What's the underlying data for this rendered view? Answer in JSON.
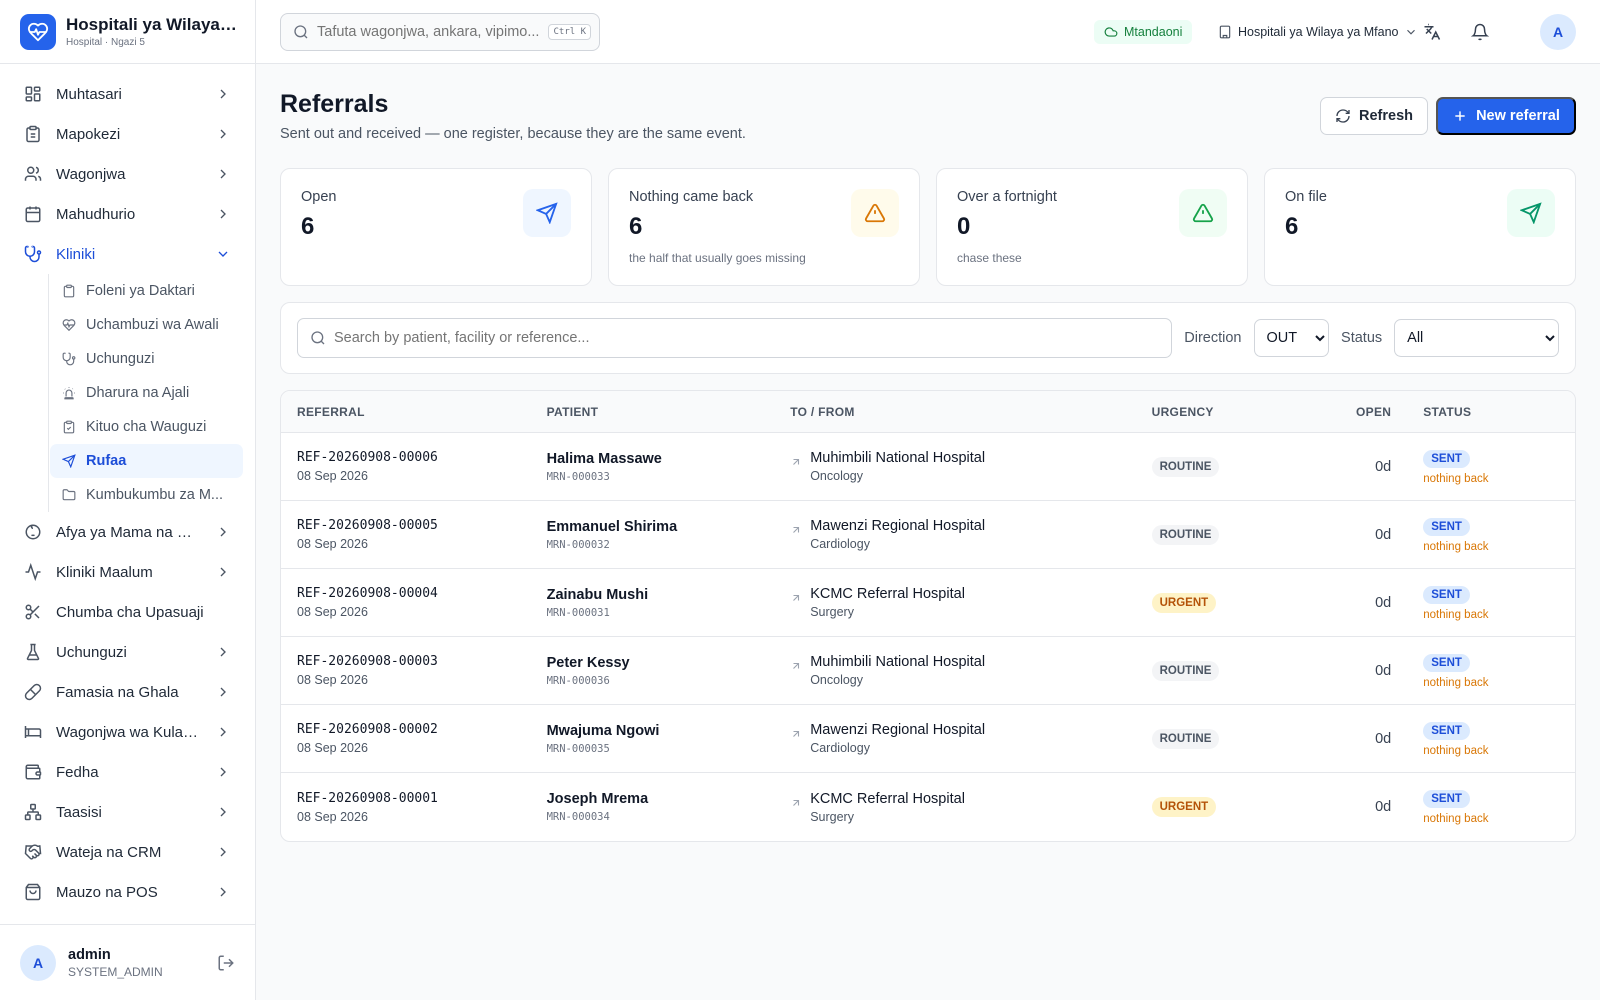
{
  "brand": {
    "name": "Hospitali ya Wilaya ...",
    "subtitle": "Hospital · Ngazi 5"
  },
  "nav": [
    {
      "label": "Muhtasari",
      "icon": "dashboard-icon"
    },
    {
      "label": "Mapokezi",
      "icon": "clipboard-icon"
    },
    {
      "label": "Wagonjwa",
      "icon": "users-icon"
    },
    {
      "label": "Mahudhurio",
      "icon": "calendar-icon"
    },
    {
      "label": "Kliniki",
      "icon": "stethoscope-icon",
      "expanded": true
    }
  ],
  "kliniki_sub": [
    {
      "label": "Foleni ya Daktari",
      "icon": "clipboard-icon"
    },
    {
      "label": "Uchambuzi wa Awali",
      "icon": "heart-pulse-icon"
    },
    {
      "label": "Uchunguzi",
      "icon": "stethoscope-icon"
    },
    {
      "label": "Dharura na Ajali",
      "icon": "siren-icon"
    },
    {
      "label": "Kituo cha Wauguzi",
      "icon": "clipboard-icon"
    },
    {
      "label": "Rufaa",
      "icon": "send-icon",
      "active": true
    },
    {
      "label": "Kumbukumbu za M...",
      "icon": "folder-icon"
    }
  ],
  "nav2": [
    {
      "label": "Afya ya Mama na Mt...",
      "icon": "baby-icon",
      "chevron": true
    },
    {
      "label": "Kliniki Maalum",
      "icon": "activity-icon",
      "chevron": true
    },
    {
      "label": "Chumba cha Upasuaji",
      "icon": "scissors-icon",
      "chevron": false
    },
    {
      "label": "Uchunguzi",
      "icon": "flask-icon",
      "chevron": true
    },
    {
      "label": "Famasia na Ghala",
      "icon": "pill-icon",
      "chevron": true
    },
    {
      "label": "Wagonjwa wa Kulaz...",
      "icon": "bed-icon",
      "chevron": true
    },
    {
      "label": "Fedha",
      "icon": "wallet-icon",
      "chevron": true
    },
    {
      "label": "Taasisi",
      "icon": "network-icon",
      "chevron": true
    },
    {
      "label": "Wateja na CRM",
      "icon": "handshake-icon",
      "chevron": true
    },
    {
      "label": "Mauzo na POS",
      "icon": "shopping-bag-icon",
      "chevron": true
    }
  ],
  "user": {
    "initial": "A",
    "name": "admin",
    "role": "SYSTEM_ADMIN"
  },
  "topbar": {
    "search_placeholder": "Tafuta wagonjwa, ankara, vipimo...",
    "shortcut": "Ctrl K",
    "online_label": "Mtandaoni",
    "facility_label": "Hospitali ya Wilaya ya Mfano",
    "avatar_initial": "A"
  },
  "page": {
    "title": "Referrals",
    "subtitle": "Sent out and received — one register, because they are the same event.",
    "refresh_label": "Refresh",
    "new_label": "New referral"
  },
  "cards": [
    {
      "label": "Open",
      "value": "6",
      "hint": "",
      "icon": "send-icon",
      "color": "#2563eb",
      "bg": "#eff6ff"
    },
    {
      "label": "Nothing came back",
      "value": "6",
      "hint": "the half that usually goes missing",
      "icon": "warning-icon",
      "color": "#d97706",
      "bg": "#fffbeb"
    },
    {
      "label": "Over a fortnight",
      "value": "0",
      "hint": "chase these",
      "icon": "alert-triangle-icon",
      "color": "#16a34a",
      "bg": "#f0fdf4"
    },
    {
      "label": "On file",
      "value": "6",
      "hint": "",
      "icon": "send-icon",
      "color": "#059669",
      "bg": "#ecfdf5"
    }
  ],
  "filters": {
    "search_placeholder": "Search by patient, facility or reference...",
    "direction_label": "Direction",
    "direction_value": "OUT",
    "status_label": "Status",
    "status_value": "All"
  },
  "table": {
    "headers": [
      "REFERRAL",
      "PATIENT",
      "TO / FROM",
      "URGENCY",
      "OPEN",
      "STATUS"
    ],
    "rows": [
      {
        "ref": "REF-20260908-00006",
        "date": "08 Sep 2026",
        "patient": "Halima Massawe",
        "mrn": "MRN-000033",
        "facility": "Muhimbili National Hospital",
        "dept": "Oncology",
        "urgency": "ROUTINE",
        "open": "0d",
        "status": "SENT",
        "note": "nothing back"
      },
      {
        "ref": "REF-20260908-00005",
        "date": "08 Sep 2026",
        "patient": "Emmanuel Shirima",
        "mrn": "MRN-000032",
        "facility": "Mawenzi Regional Hospital",
        "dept": "Cardiology",
        "urgency": "ROUTINE",
        "open": "0d",
        "status": "SENT",
        "note": "nothing back"
      },
      {
        "ref": "REF-20260908-00004",
        "date": "08 Sep 2026",
        "patient": "Zainabu Mushi",
        "mrn": "MRN-000031",
        "facility": "KCMC Referral Hospital",
        "dept": "Surgery",
        "urgency": "URGENT",
        "open": "0d",
        "status": "SENT",
        "note": "nothing back"
      },
      {
        "ref": "REF-20260908-00003",
        "date": "08 Sep 2026",
        "patient": "Peter Kessy",
        "mrn": "MRN-000036",
        "facility": "Muhimbili National Hospital",
        "dept": "Oncology",
        "urgency": "ROUTINE",
        "open": "0d",
        "status": "SENT",
        "note": "nothing back"
      },
      {
        "ref": "REF-20260908-00002",
        "date": "08 Sep 2026",
        "patient": "Mwajuma Ngowi",
        "mrn": "MRN-000035",
        "facility": "Mawenzi Regional Hospital",
        "dept": "Cardiology",
        "urgency": "ROUTINE",
        "open": "0d",
        "status": "SENT",
        "note": "nothing back"
      },
      {
        "ref": "REF-20260908-00001",
        "date": "08 Sep 2026",
        "patient": "Joseph Mrema",
        "mrn": "MRN-000034",
        "facility": "KCMC Referral Hospital",
        "dept": "Surgery",
        "urgency": "URGENT",
        "open": "0d",
        "status": "SENT",
        "note": "nothing back"
      }
    ]
  },
  "colors": {
    "accent": "#2563eb",
    "online": "#15803d",
    "urgent": "#b45309",
    "warning_text": "#d97706"
  }
}
